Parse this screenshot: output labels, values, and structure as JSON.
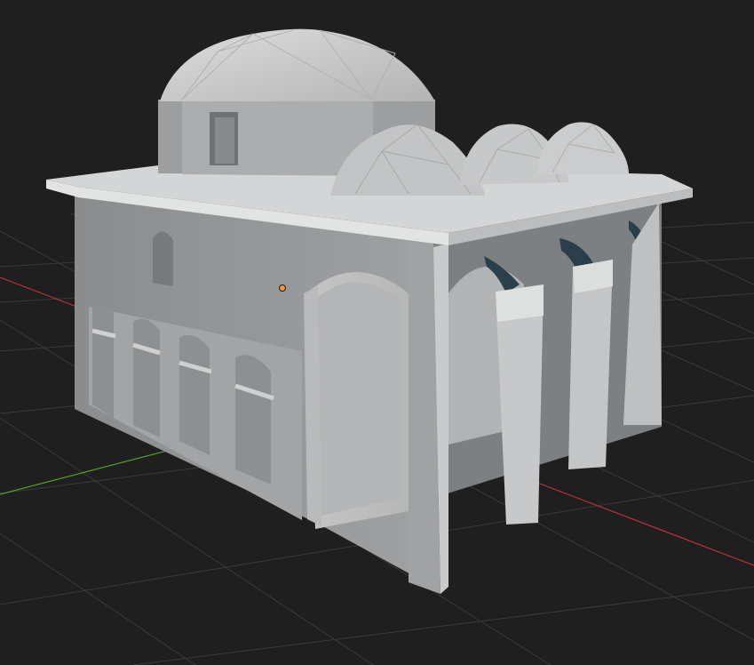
{
  "viewport": {
    "background_color": "#1f1f1f",
    "grid_color": "#3a3a3a",
    "x_axis_color": "#b8323a",
    "y_axis_color": "#5a9a2a",
    "origin_marker_color": "#f29a3c"
  },
  "model": {
    "description_icon": "mosque-3d-model",
    "wall_color": "#a8aaab",
    "dome_color": "#c9cacb",
    "roof_color": "#d2d3d4",
    "shadow_color": "#6d7072",
    "arch_interior_color": "#2b3e4c"
  }
}
